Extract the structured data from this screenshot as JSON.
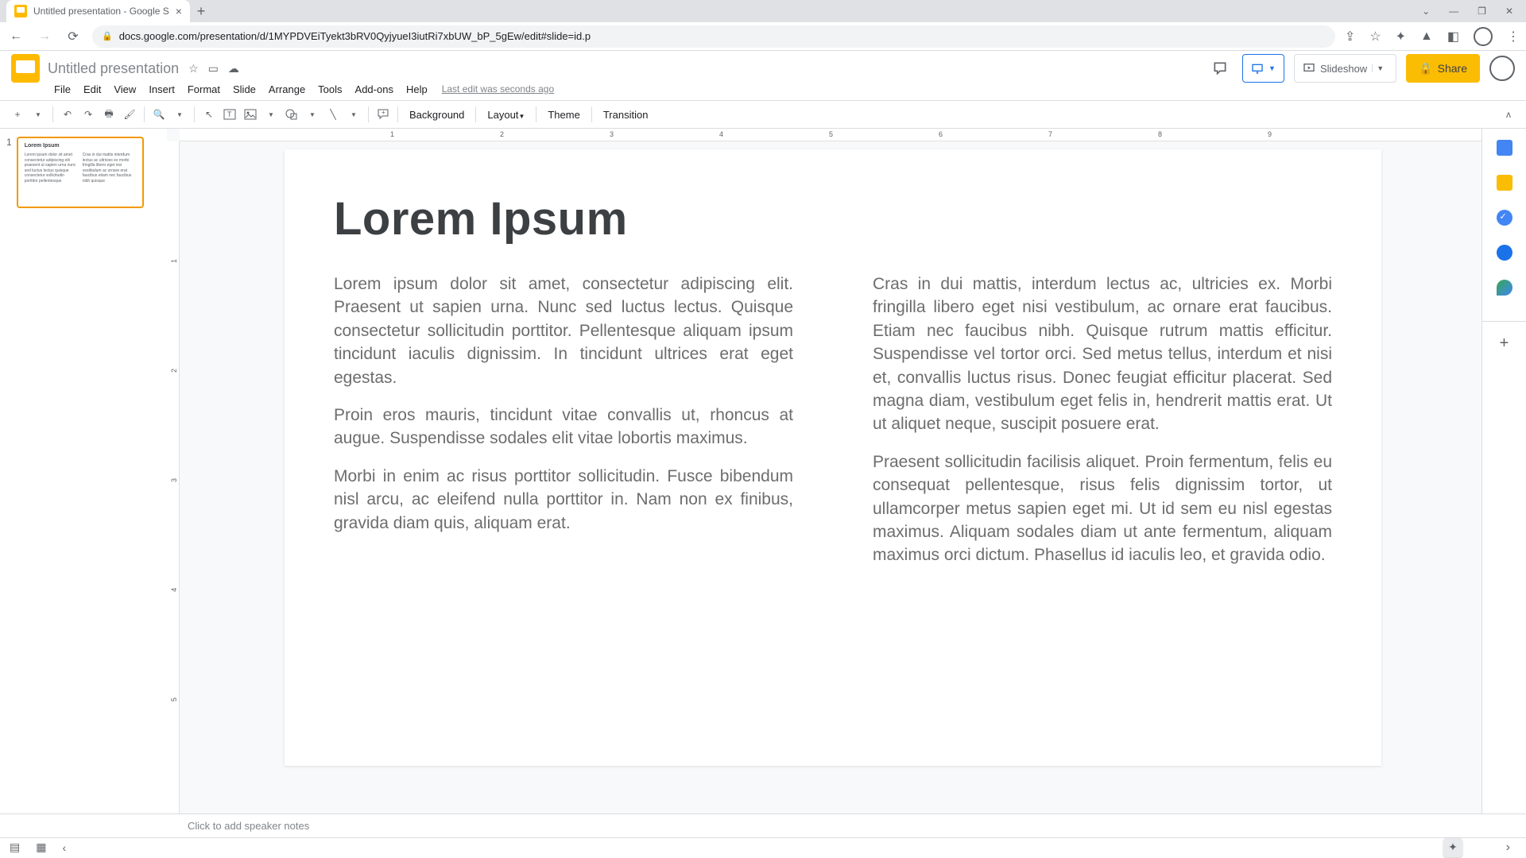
{
  "browser": {
    "tab_title": "Untitled presentation - Google S",
    "url": "docs.google.com/presentation/d/1MYPDVEiTyekt3bRV0QyjyueI3iutRi7xbUW_bP_5gEw/edit#slide=id.p"
  },
  "doc": {
    "name": "Untitled presentation",
    "last_edit": "Last edit was seconds ago"
  },
  "menus": [
    "File",
    "Edit",
    "View",
    "Insert",
    "Format",
    "Slide",
    "Arrange",
    "Tools",
    "Add-ons",
    "Help"
  ],
  "header": {
    "slideshow": "Slideshow",
    "share": "Share"
  },
  "toolbar": {
    "background": "Background",
    "layout": "Layout",
    "theme": "Theme",
    "transition": "Transition"
  },
  "ruler_h": [
    "1",
    "2",
    "3",
    "4",
    "5",
    "6",
    "7",
    "8",
    "9"
  ],
  "ruler_v": [
    "1",
    "2",
    "3",
    "4",
    "5"
  ],
  "slide": {
    "title": "Lorem Ipsum",
    "left": [
      "Lorem ipsum dolor sit amet, consectetur adipiscing elit. Praesent ut sapien urna. Nunc sed luctus lectus. Quisque consectetur sollicitudin porttitor. Pellentesque aliquam ipsum tincidunt iaculis dignissim. In tincidunt ultrices erat eget egestas.",
      "Proin eros mauris, tincidunt vitae convallis ut, rhoncus at augue. Suspendisse sodales elit vitae lobortis maximus.",
      "Morbi in enim ac risus porttitor sollicitudin. Fusce bibendum nisl arcu, ac eleifend nulla porttitor in. Nam non ex finibus, gravida diam quis, aliquam erat."
    ],
    "right": [
      "Cras in dui mattis, interdum lectus ac, ultricies ex. Morbi fringilla libero eget nisi vestibulum, ac ornare erat faucibus. Etiam nec faucibus nibh. Quisque rutrum mattis efficitur. Suspendisse vel tortor orci. Sed metus tellus, interdum et nisi et, convallis luctus risus. Donec feugiat efficitur placerat. Sed magna diam, vestibulum eget felis in, hendrerit mattis erat. Ut ut aliquet neque, suscipit posuere erat.",
      "Praesent sollicitudin facilisis aliquet. Proin fermentum, felis eu consequat pellentesque, risus felis dignissim tortor, ut ullamcorper metus sapien eget mi. Ut id sem eu nisl egestas maximus. Aliquam sodales diam ut ante fermentum, aliquam maximus orci dictum. Phasellus id iaculis leo, et gravida odio."
    ]
  },
  "thumb": {
    "title": "Lorem Ipsum"
  },
  "notes": {
    "placeholder": "Click to add speaker notes"
  },
  "filmstrip": {
    "slide_num": "1"
  }
}
